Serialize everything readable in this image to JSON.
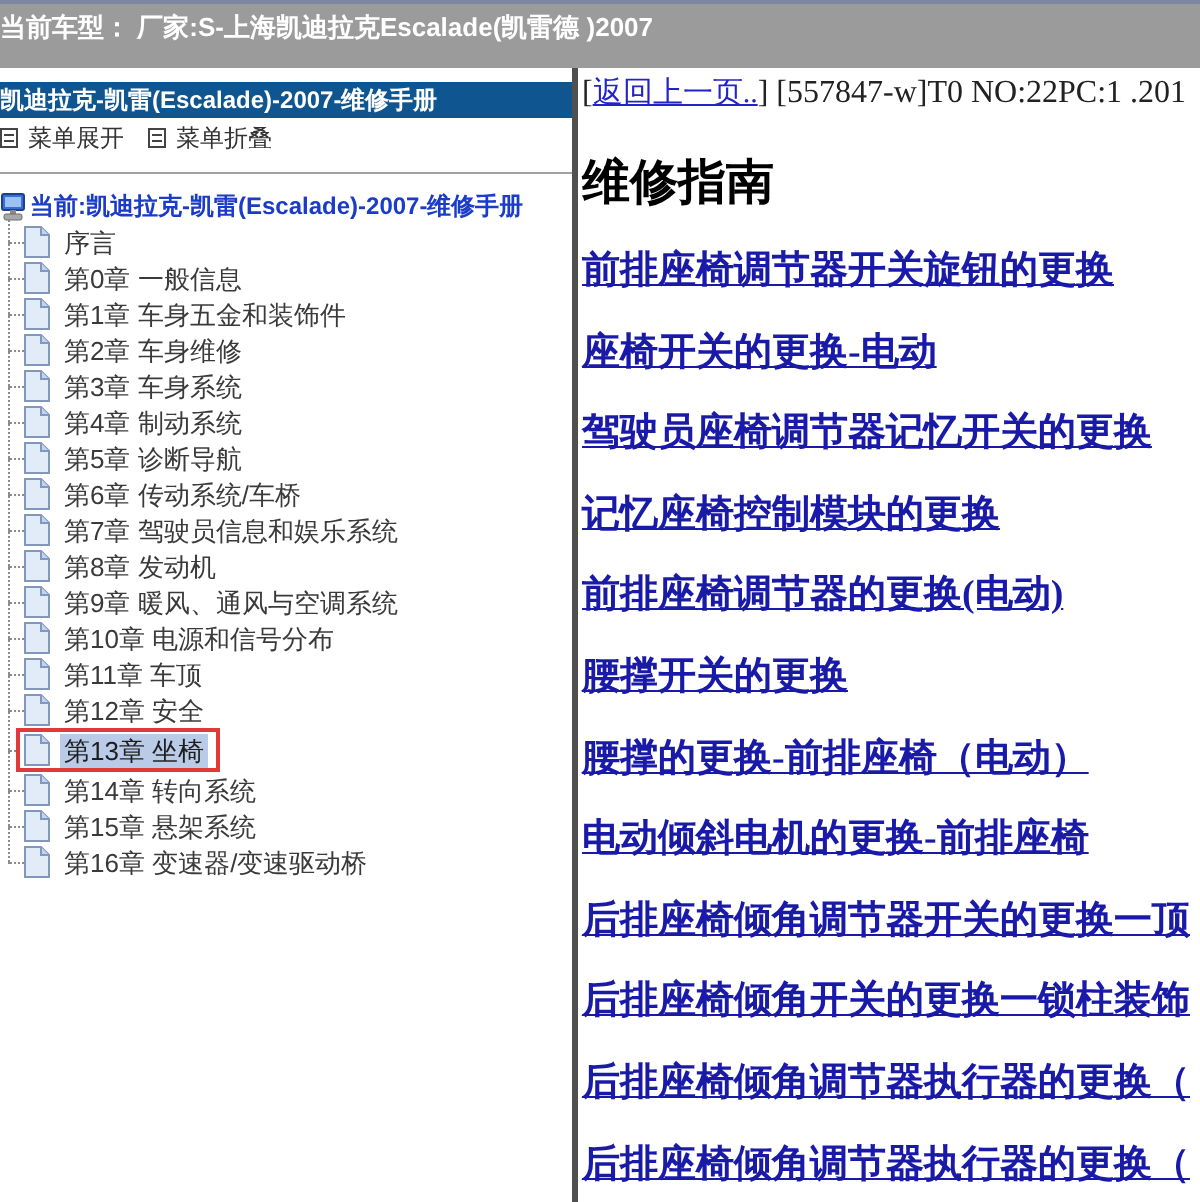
{
  "top_bar": {
    "text": "当前车型： 厂家:S-上海凯迪拉克Escalade(凯雷德 )2007"
  },
  "sidebar": {
    "title": "凯迪拉克-凯雷(Escalade)-2007-维修手册",
    "menu_buttons": [
      {
        "label": "菜单展开"
      },
      {
        "label": "菜单折叠"
      }
    ],
    "tree": {
      "label": "当前:凯迪拉克-凯雷(Escalade)-2007-维修手册",
      "children": [
        {
          "label": "序言",
          "selected": false,
          "annotated": false
        },
        {
          "label": "第0章 一般信息",
          "selected": false,
          "annotated": false
        },
        {
          "label": "第1章 车身五金和装饰件",
          "selected": false,
          "annotated": false
        },
        {
          "label": "第2章 车身维修",
          "selected": false,
          "annotated": false
        },
        {
          "label": "第3章 车身系统",
          "selected": false,
          "annotated": false
        },
        {
          "label": "第4章 制动系统",
          "selected": false,
          "annotated": false
        },
        {
          "label": "第5章 诊断导航",
          "selected": false,
          "annotated": false
        },
        {
          "label": "第6章 传动系统/车桥",
          "selected": false,
          "annotated": false
        },
        {
          "label": "第7章 驾驶员信息和娱乐系统",
          "selected": false,
          "annotated": false
        },
        {
          "label": "第8章 发动机",
          "selected": false,
          "annotated": false
        },
        {
          "label": "第9章 暖风、通风与空调系统",
          "selected": false,
          "annotated": false
        },
        {
          "label": "第10章 电源和信号分布",
          "selected": false,
          "annotated": false
        },
        {
          "label": "第11章 车顶",
          "selected": false,
          "annotated": false
        },
        {
          "label": "第12章 安全",
          "selected": false,
          "annotated": false
        },
        {
          "label": "第13章 坐椅",
          "selected": true,
          "annotated": true
        },
        {
          "label": "第14章 转向系统",
          "selected": false,
          "annotated": false
        },
        {
          "label": "第15章 悬架系统",
          "selected": false,
          "annotated": false
        },
        {
          "label": "第16章 变速器/变速驱动桥",
          "selected": false,
          "annotated": false
        }
      ]
    }
  },
  "content": {
    "info_line": {
      "before": "[",
      "link": "返回上一页..",
      "after": "] [557847-w]T0 NO:22PC:1 .201"
    },
    "heading": "维修指南",
    "links": [
      "前排座椅调节器开关旋钮的更换",
      "座椅开关的更换-电动",
      "驾驶员座椅调节器记忆开关的更换",
      "记忆座椅控制模块的更换",
      "前排座椅调节器的更换(电动)",
      "腰撑开关的更换",
      "腰撑的更换-前排座椅（电动）",
      "电动倾斜电机的更换-前排座椅",
      "后排座椅倾角调节器开关的更换一顶",
      "后排座椅倾角开关的更换一锁柱装饰",
      "后排座椅倾角调节器执行器的更换（",
      "后排座椅倾角调节器执行器的更换（"
    ]
  }
}
